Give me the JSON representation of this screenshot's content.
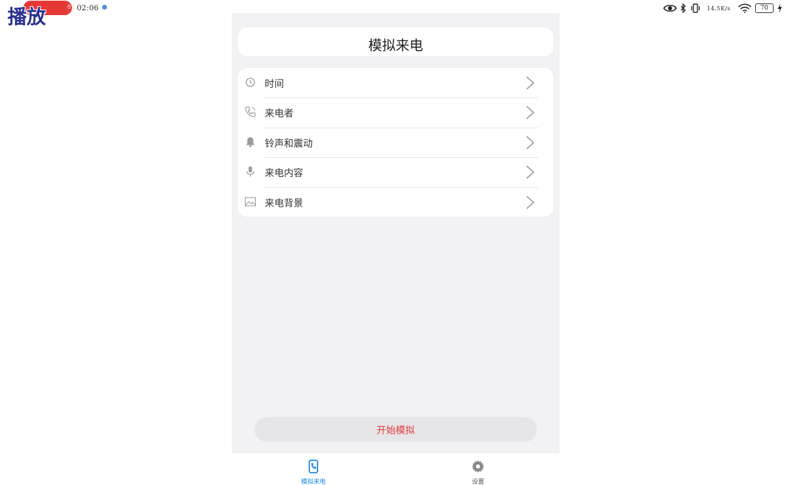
{
  "status_bar": {
    "recording_badge": "01",
    "overlay_label": "播放",
    "time": "02:06",
    "net_speed": "14.5K/s",
    "battery_level": "70",
    "icons": [
      "eye-icon",
      "bluetooth-icon",
      "vibrate-icon",
      "wifi-icon",
      "battery-icon",
      "charging-icon"
    ]
  },
  "header": {
    "title": "模拟来电"
  },
  "menu": {
    "items": [
      {
        "label": "时间",
        "icon": "clock-icon"
      },
      {
        "label": "来电者",
        "icon": "phone-icon"
      },
      {
        "label": "铃声和震动",
        "icon": "bell-icon"
      },
      {
        "label": "来电内容",
        "icon": "microphone-icon"
      },
      {
        "label": "来电背景",
        "icon": "image-icon"
      }
    ]
  },
  "actions": {
    "start_label": "开始模拟"
  },
  "bottom_nav": {
    "items": [
      {
        "label": "模拟来电",
        "icon": "phone-screen-icon",
        "active": true
      },
      {
        "label": "设置",
        "icon": "gear-icon",
        "active": false
      }
    ]
  },
  "colors": {
    "accent": "#1e88e5",
    "start_text": "#e03a3a",
    "recording": "#e53935",
    "panel_bg": "#f2f1f4"
  }
}
